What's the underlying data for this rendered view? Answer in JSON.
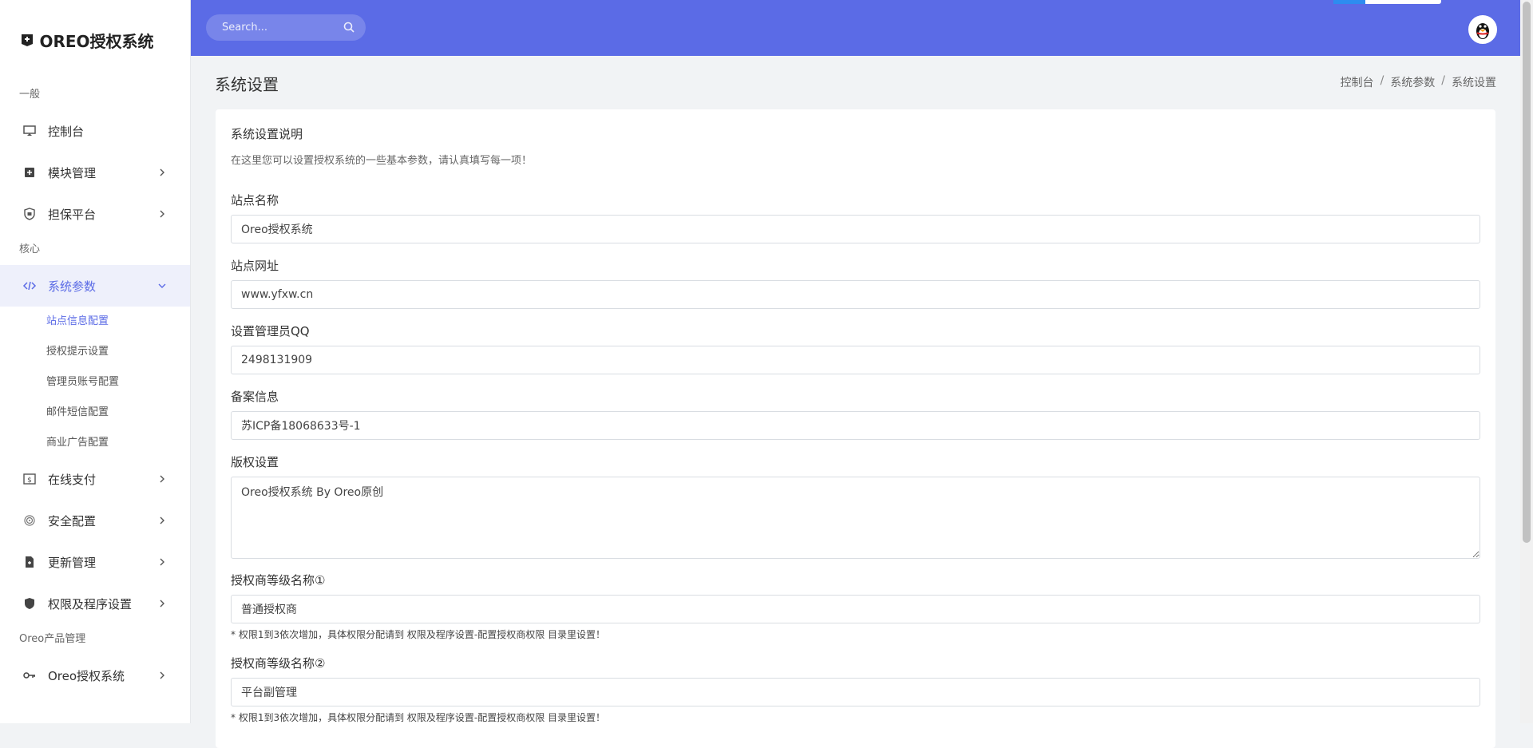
{
  "brand": {
    "title": "OREO授权系统"
  },
  "header": {
    "search_placeholder": "Search..."
  },
  "sidebar": {
    "sections": [
      "一般",
      "核心",
      "Oreo产品管理"
    ],
    "items": [
      {
        "label": "控制台",
        "icon": "monitor-icon"
      },
      {
        "label": "模块管理",
        "icon": "module-icon"
      },
      {
        "label": "担保平台",
        "icon": "shield-check-icon"
      },
      {
        "label": "系统参数",
        "icon": "code-icon"
      },
      {
        "label": "在线支付",
        "icon": "dollar-card-icon"
      },
      {
        "label": "安全配置",
        "icon": "fingerprint-icon"
      },
      {
        "label": "更新管理",
        "icon": "file-update-icon"
      },
      {
        "label": "权限及程序设置",
        "icon": "shield-icon"
      },
      {
        "label": "Oreo授权系统",
        "icon": "key-icon"
      }
    ],
    "sub_items": [
      "站点信息配置",
      "授权提示设置",
      "管理员账号配置",
      "邮件短信配置",
      "商业广告配置"
    ]
  },
  "page": {
    "title": "系统设置",
    "breadcrumb": [
      "控制台",
      "系统参数",
      "系统设置"
    ],
    "breadcrumb_sep": "/"
  },
  "form": {
    "desc_title": "系统设置说明",
    "desc_text": "在这里您可以设置授权系统的一些基本参数，请认真填写每一项！",
    "site_name_label": "站点名称",
    "site_name_value": "Oreo授权系统",
    "site_url_label": "站点网址",
    "site_url_value": "www.yfxw.cn",
    "admin_qq_label": "设置管理员QQ",
    "admin_qq_value": "2498131909",
    "icp_label": "备案信息",
    "icp_value": "苏ICP备18068633号-1",
    "copyright_label": "版权设置",
    "copyright_value": "Oreo授权系统 By Oreo原创",
    "level1_label": "授权商等级名称①",
    "level1_value": "普通授权商",
    "level1_hint": "* 权限1到3依次增加，具体权限分配请到 权限及程序设置-配置授权商权限 目录里设置！",
    "level2_label": "授权商等级名称②",
    "level2_value": "平台副管理",
    "level2_hint": "* 权限1到3依次增加，具体权限分配请到 权限及程序设置-配置授权商权限 目录里设置！"
  },
  "colors": {
    "accent": "#5b6be6",
    "active_bg": "#eef0fb"
  }
}
